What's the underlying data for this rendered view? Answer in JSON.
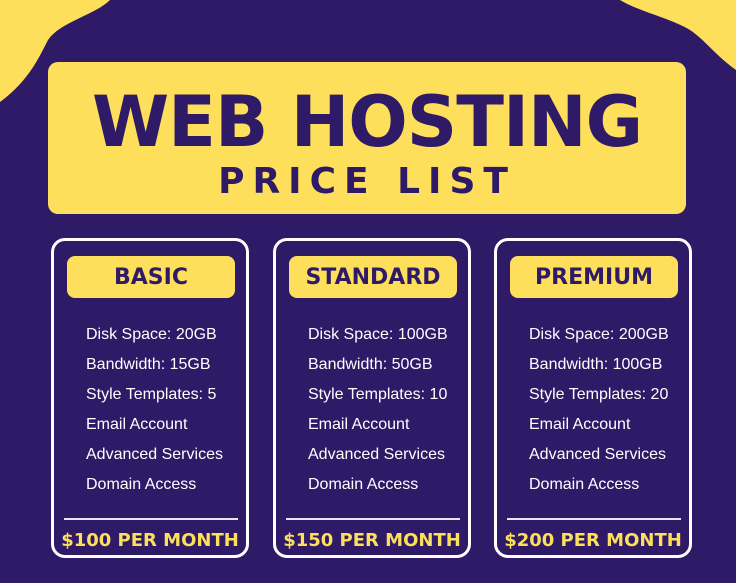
{
  "header": {
    "title": "WEB HOSTING",
    "subtitle": "PRICE LIST"
  },
  "colors": {
    "background": "#2e1a66",
    "accent": "#fddf5c",
    "text": "#ffffff"
  },
  "plans": [
    {
      "name": "BASIC",
      "features": [
        "Disk Space: 20GB",
        "Bandwidth: 15GB",
        "Style Templates: 5",
        "Email Account",
        "Advanced Services",
        "Domain Access"
      ],
      "price": "$100 PER MONTH"
    },
    {
      "name": "STANDARD",
      "features": [
        "Disk Space: 100GB",
        "Bandwidth: 50GB",
        "Style Templates: 10",
        "Email Account",
        "Advanced Services",
        "Domain Access"
      ],
      "price": "$150 PER MONTH"
    },
    {
      "name": "PREMIUM",
      "features": [
        "Disk Space: 200GB",
        "Bandwidth: 100GB",
        "Style Templates: 20",
        "Email Account",
        "Advanced Services",
        "Domain Access"
      ],
      "price": "$200 PER MONTH"
    }
  ]
}
